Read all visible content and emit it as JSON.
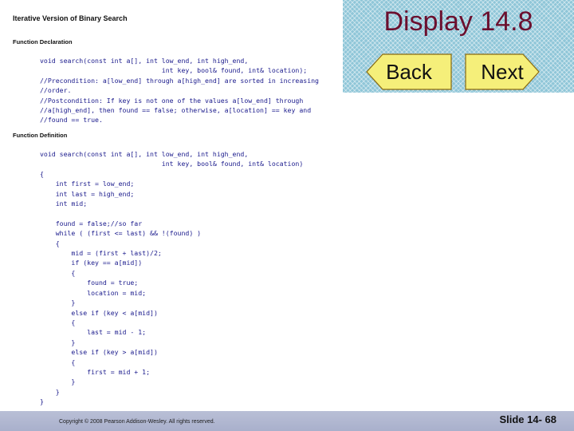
{
  "doc": {
    "title": "Iterative Version of Binary Search",
    "declaration_heading": "Function Declaration",
    "definition_heading": "Function Definition",
    "declaration_code": "void search(const int a[], int low_end, int high_end,\n                               int key, bool& found, int& location);\n//Precondition: a[low_end] through a[high_end] are sorted in increasing\n//order.\n//Postcondition: If key is not one of the values a[low_end] through\n//a[high_end], then found == false; otherwise, a[location] == key and\n//found == true.",
    "definition_code": "void search(const int a[], int low_end, int high_end,\n                               int key, bool& found, int& location)\n{\n    int first = low_end;\n    int last = high_end;\n    int mid;\n\n    found = false;//so far\n    while ( (first <= last) && !(found) )\n    {\n        mid = (first + last)/2;\n        if (key == a[mid])\n        {\n            found = true;\n            location = mid;\n        }\n        else if (key < a[mid])\n        {\n            last = mid - 1;\n        }\n        else if (key > a[mid])\n        {\n            first = mid + 1;\n        }\n    }\n}"
  },
  "header": {
    "display_title": "Display 14.8",
    "back_label": "Back",
    "next_label": "Next",
    "accent_color": "#6b0f2e",
    "button_color": "#f5ef7a"
  },
  "footer": {
    "copyright": "Copyright © 2008 Pearson Addison-Wesley.  All rights reserved.",
    "slide_number": "Slide 14- 68"
  }
}
